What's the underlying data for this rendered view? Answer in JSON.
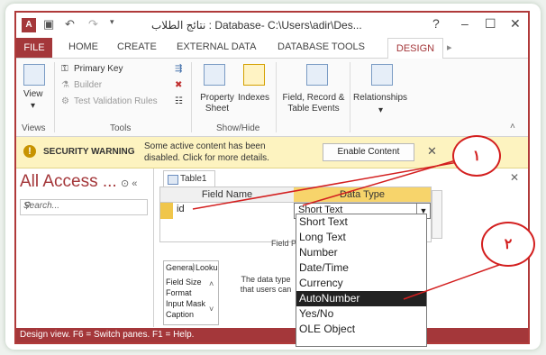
{
  "window": {
    "title": "نتائج الطلاب : Database- C:\\Users\\adir\\Des...",
    "controls": [
      "?",
      "–",
      "☐",
      "✕"
    ]
  },
  "tabs": [
    "FILE",
    "HOME",
    "CREATE",
    "EXTERNAL DATA",
    "DATABASE TOOLS",
    "DESIGN"
  ],
  "ribbon": {
    "view": "View",
    "primary_key": "Primary Key",
    "builder": "Builder",
    "test_validation": "Test Validation Rules",
    "property_sheet": "Property Sheet",
    "indexes": "Indexes",
    "field_record_events": "Field, Record & Table Events",
    "relationships": "Relationships",
    "groups": [
      "Views",
      "Tools",
      "Show/Hide"
    ]
  },
  "security": {
    "heading": "SECURITY WARNING",
    "message": "Some active content has been disabled. Click for more details.",
    "button": "Enable Content"
  },
  "nav": {
    "title": "All Access ...",
    "search_placeholder": "Search..."
  },
  "table": {
    "tab": "Table1",
    "col_field": "Field Name",
    "col_type": "Data Type",
    "field_value": "id",
    "type_value": "Short Text",
    "field_props": "Field P",
    "general_tab": "General",
    "lookup_tab": "Looku",
    "props": [
      "Field Size",
      "Format",
      "Input Mask",
      "Caption"
    ],
    "help": "The data type that users can"
  },
  "dropdown_options": [
    "Short Text",
    "Long Text",
    "Number",
    "Date/Time",
    "Currency",
    "AutoNumber",
    "Yes/No",
    "OLE Object"
  ],
  "dropdown_selected": 5,
  "status": "Design view.  F6 = Switch panes.  F1 = Help.",
  "annotations": [
    "١",
    "٢"
  ]
}
